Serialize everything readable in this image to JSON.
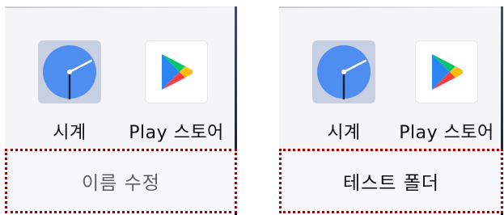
{
  "colors": {
    "highlight_border": "#a80000",
    "clock_tile_bg": "#c7d0e2",
    "clock_face": "#4f8df0"
  },
  "left_panel": {
    "apps": [
      {
        "label": "시계",
        "icon": "clock-icon"
      },
      {
        "label": "Play 스토어",
        "icon": "play-store-icon"
      }
    ],
    "name_field": {
      "text": "이름 수정",
      "color": "#5f5f5f"
    }
  },
  "right_panel": {
    "apps": [
      {
        "label": "시계",
        "icon": "clock-icon"
      },
      {
        "label": "Play 스토어",
        "icon": "play-store-icon"
      }
    ],
    "name_field": {
      "text": "테스트 폴더",
      "color": "#111111"
    }
  }
}
